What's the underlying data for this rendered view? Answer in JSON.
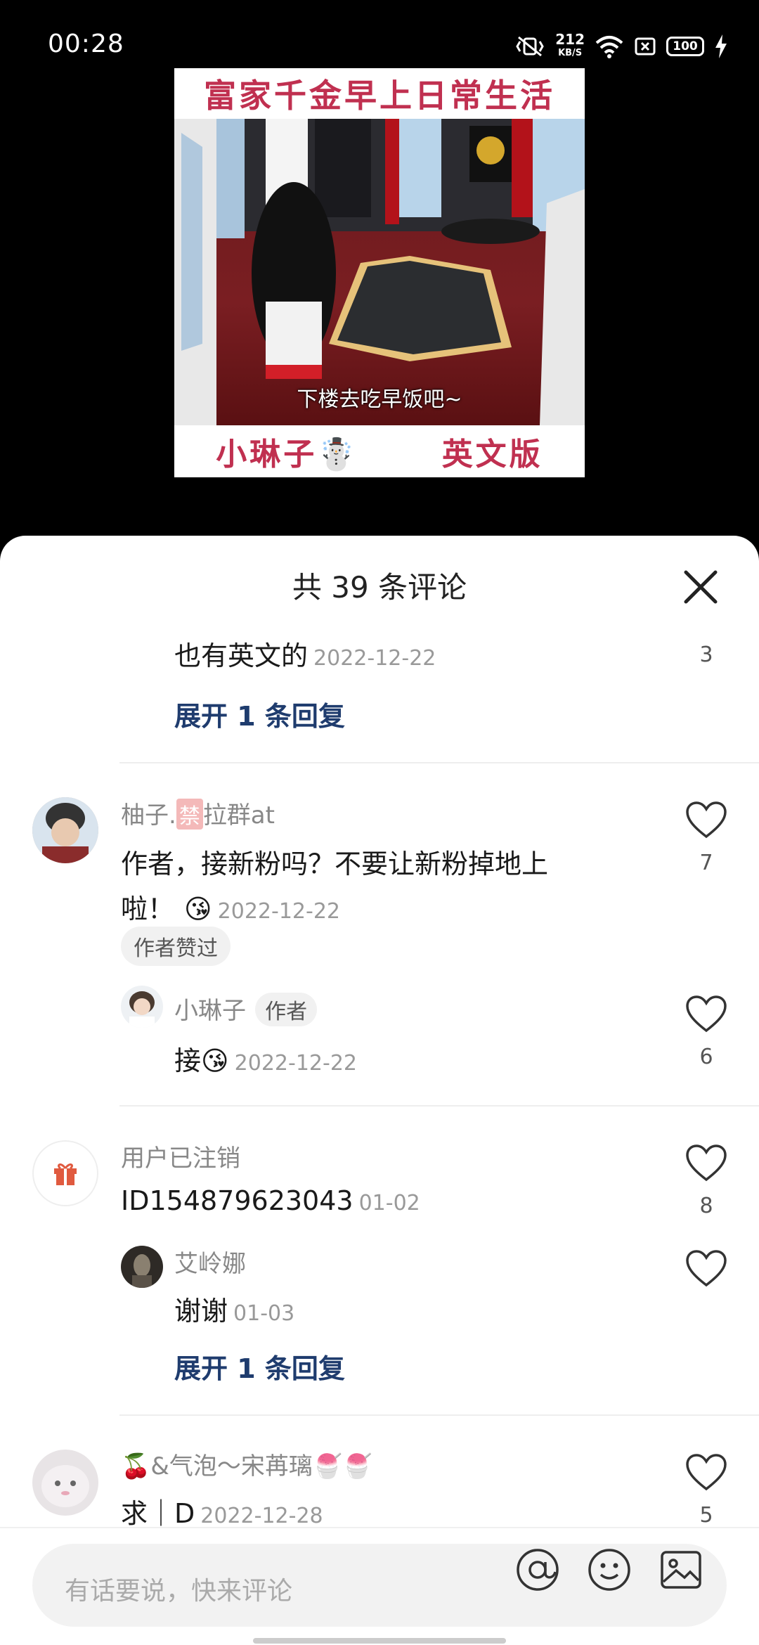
{
  "status_bar": {
    "time": "00:28",
    "net_speed_value": "212",
    "net_speed_unit": "KB/S",
    "battery": "100"
  },
  "video": {
    "title": "富家千金早上日常生活",
    "subtitle": "下楼去吃早饭吧~",
    "bottom_left": "小琳子☃️",
    "bottom_right": "英文版"
  },
  "comments_sheet": {
    "title": "共 39 条评论",
    "partial_comment": {
      "text": "也有英文的",
      "date": "2022-12-22",
      "likes": "3",
      "expand": "展开 1 条回复"
    },
    "comments": [
      {
        "user": "柚子.",
        "user_tag": "禁",
        "user_suffix": "拉群at",
        "text_line1": "作者，接新粉吗？不要让新粉掉地上",
        "text_line2": "啦！",
        "emoji": "😘",
        "date": "2022-12-22",
        "likes": "7",
        "badge": "作者赞过",
        "reply": {
          "user": "小琳子",
          "author_tag": "作者",
          "text": "接",
          "emoji": "😘",
          "date": "2022-12-22",
          "likes": "6"
        }
      },
      {
        "user": "用户已注销",
        "text": "ID154879623043",
        "date": "01-02",
        "likes": "8",
        "reply": {
          "user": "艾岭娜",
          "text": "谢谢",
          "date": "01-03"
        },
        "expand": "展开 1 条回复"
      },
      {
        "user": "🍒&气泡～宋苒璃🍧🍧",
        "text": "求｜D",
        "date": "2022-12-28",
        "likes": "5"
      }
    ]
  },
  "input": {
    "placeholder": "有话要说，快来评论"
  }
}
